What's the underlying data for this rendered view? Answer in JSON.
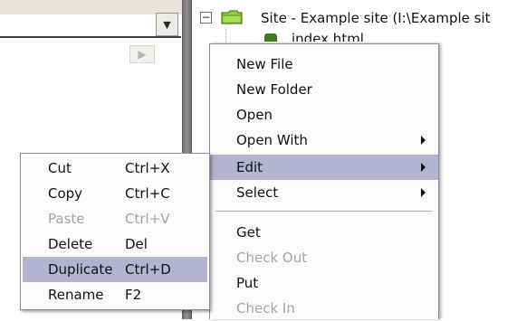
{
  "tree": {
    "site_label": "Site - Example site (I:\\Example sit",
    "toggle_symbol": "−",
    "selected_file": "index.html"
  },
  "left_panel": {
    "dropdown_glyph": "▼",
    "scroll_glyph": "▶"
  },
  "context_menu": {
    "items": [
      {
        "label": "New File",
        "enabled": true,
        "submenu": false
      },
      {
        "label": "New Folder",
        "enabled": true,
        "submenu": false
      },
      {
        "label": "Open",
        "enabled": true,
        "submenu": false
      },
      {
        "label": "Open With",
        "enabled": true,
        "submenu": true
      },
      {
        "label": "Edit",
        "enabled": true,
        "submenu": true,
        "highlighted": true
      },
      {
        "label": "Select",
        "enabled": true,
        "submenu": true
      },
      {
        "label": "Get",
        "enabled": true,
        "submenu": false
      },
      {
        "label": "Check Out",
        "enabled": false,
        "submenu": false
      },
      {
        "label": "Put",
        "enabled": true,
        "submenu": false
      },
      {
        "label": "Check In",
        "enabled": false,
        "submenu": false
      }
    ]
  },
  "edit_submenu": {
    "items": [
      {
        "label": "Cut",
        "shortcut": "Ctrl+X",
        "enabled": true
      },
      {
        "label": "Copy",
        "shortcut": "Ctrl+C",
        "enabled": true
      },
      {
        "label": "Paste",
        "shortcut": "Ctrl+V",
        "enabled": false
      },
      {
        "label": "Delete",
        "shortcut": "Del",
        "enabled": true
      },
      {
        "label": "Duplicate",
        "shortcut": "Ctrl+D",
        "enabled": true,
        "highlighted": true
      },
      {
        "label": "Rename",
        "shortcut": "F2",
        "enabled": true
      }
    ]
  },
  "colors": {
    "highlight": "#b3b4cf",
    "disabled_text": "#a4a4a4",
    "folder_green": "#7fbf2a"
  },
  "icons": [
    "dropdown-arrow-icon",
    "scroll-right-icon",
    "collapse-icon",
    "folder-icon",
    "html-page-icon",
    "submenu-arrow-icon"
  ]
}
